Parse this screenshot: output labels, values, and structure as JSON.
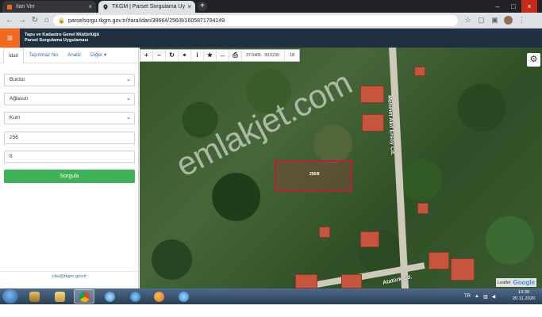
{
  "browser": {
    "tabs": [
      {
        "title": "İlan Ver",
        "active": false
      },
      {
        "title": "TKGM | Parsel Sorgulama Uygulama",
        "active": true
      }
    ],
    "url": "parselsorgu.tkgm.gov.tr/#ara/idari/39664/256/8/1605871794149"
  },
  "app": {
    "title_line1": "Tapu ve Kadastro Genel Müdürlüğü",
    "title_line2": "Parsel Sorgulama Uygulaması"
  },
  "panel": {
    "tabs": [
      "İdari",
      "Taşınmaz No",
      "Analiz",
      "Diğer ▾"
    ],
    "fields": {
      "province": "Burdur",
      "district": "Ağlasun",
      "neighborhood": "Kum",
      "block": "256",
      "parcel": "8"
    },
    "query_label": "Sorgula",
    "contact": "cbs@tkgm.gov.tr"
  },
  "map": {
    "coords": "37.6466 : 30.5230",
    "zoom": "18",
    "parcel_label": "256/8",
    "watermark": "emlakjet.com",
    "street1": "Mehmet Akif Ersoy Cd.",
    "street2": "Atatürk Cd.",
    "attribution": "Leaflet",
    "provider": "Google"
  },
  "taskbar": {
    "lang": "TR",
    "time": "13:30",
    "date": "20.11.2020"
  },
  "colors": {
    "header": "#1f3040",
    "accent": "#f26a21",
    "button": "#3fb158",
    "parcel_border": "#b0233a"
  }
}
